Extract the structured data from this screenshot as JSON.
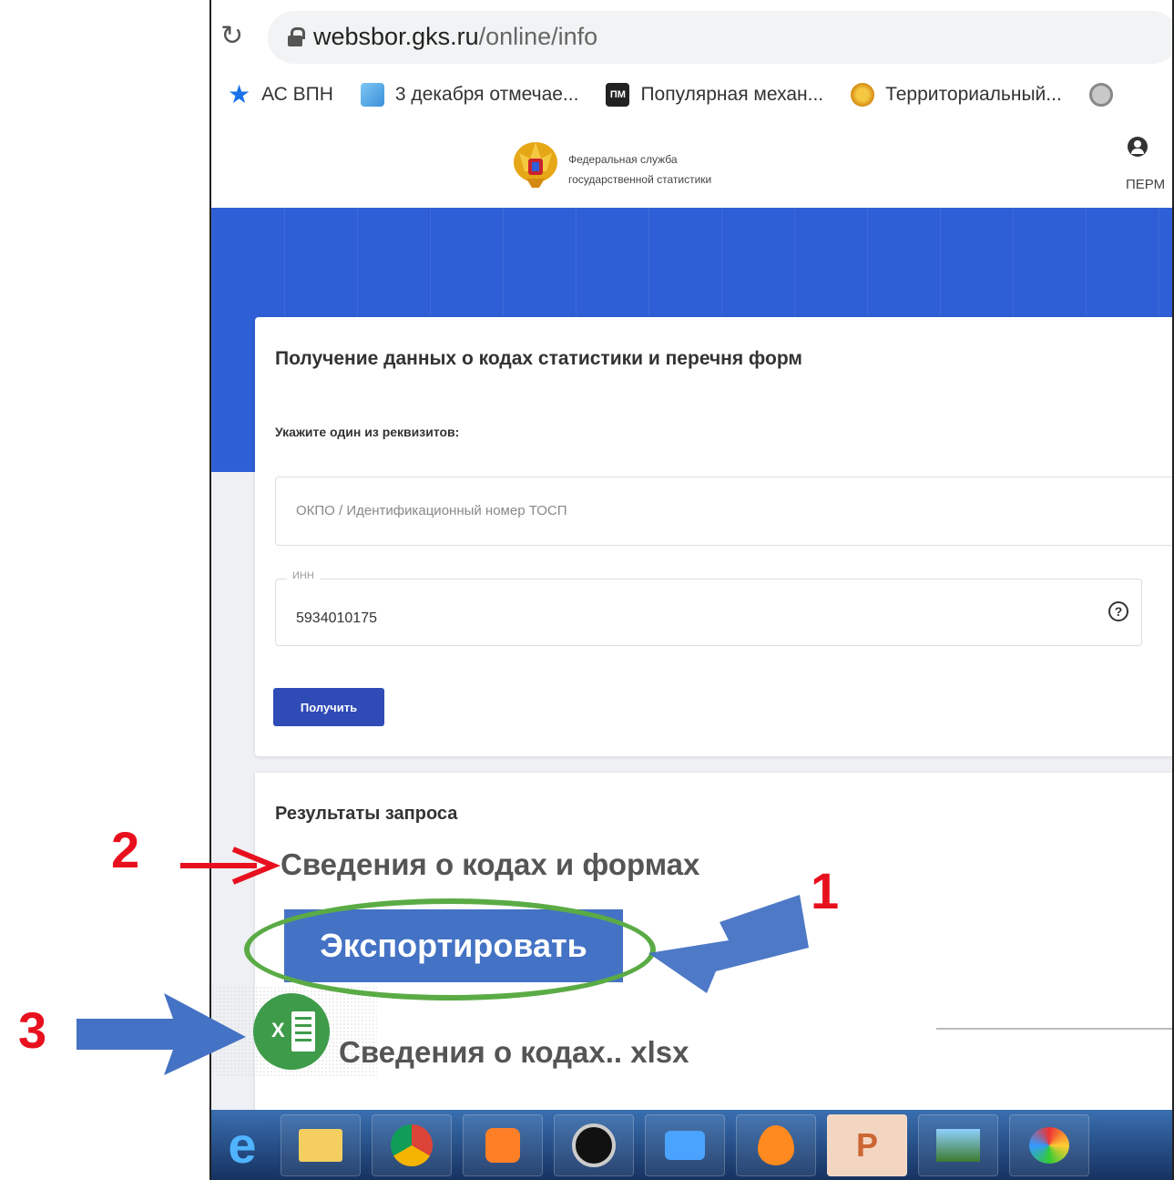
{
  "browser": {
    "url_domain": "websbor.gks.ru",
    "url_path": "/online/info",
    "bookmarks": [
      "АС ВПН",
      "3 декабря отмечае...",
      "Популярная механ...",
      "Территориальный..."
    ],
    "pm_icon_text": "ПМ"
  },
  "site": {
    "agency_line1": "Федеральная служба",
    "agency_line2": "государственной статистики",
    "user_region": "ПЕРМ"
  },
  "form": {
    "title": "Получение данных о кодах статистики и перечня форм",
    "requisites_label": "Укажите один из реквизитов:",
    "okpo_placeholder": "ОКПО / Идентификационный номер ТОСП",
    "inn_label": "ИНН",
    "inn_value": "5934010175",
    "help_glyph": "?",
    "submit_label": "Получить"
  },
  "results": {
    "title": "Результаты запроса",
    "info_heading": "Сведения о кодах и формах",
    "export_label": "Экспортировать",
    "file_label": "Сведения о кодах.. xlsx",
    "excel_letter": "X"
  },
  "annotations": {
    "n1": "1",
    "n2": "2",
    "n3": "3",
    "arrow_red": "#e8101e",
    "arrow_blue": "#4472c4",
    "ellipse_green": "#5aab45"
  },
  "taskbar_apps": [
    "ie-icon",
    "explorer-icon",
    "chrome-icon",
    "media-icon",
    "camera-icon",
    "video-icon",
    "fire-icon",
    "powerpoint-icon",
    "photo-icon",
    "paint-icon"
  ],
  "taskbar_glyphs": {
    "ie": "e",
    "ppt": "P"
  }
}
